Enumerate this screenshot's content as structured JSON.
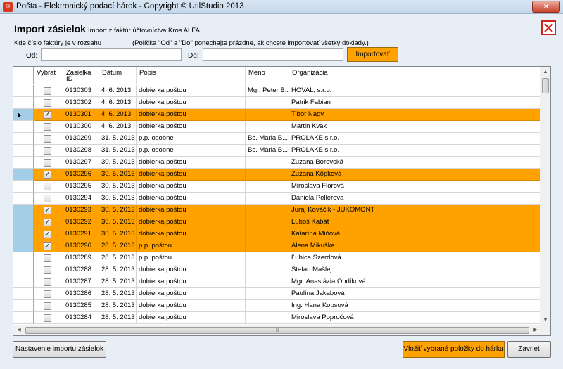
{
  "window": {
    "title": "Pošta - Elektronický podací hárok - Copyright © UtilStudio 2013",
    "close_glyph": "✕"
  },
  "header": {
    "title": "Import zásielok",
    "subtitle": "Import z faktúr účtovníctva Kros ALFA"
  },
  "range": {
    "label": "Kde číslo faktúry je v rozsahu",
    "hint": "(Políčka \"Od\" a \"Do\" ponechajte prázdne, ak chcete importovať všetky doklady.)",
    "od_label": "Od:",
    "od_value": "",
    "do_label": "Do:",
    "do_value": "",
    "import_button": "Importovať"
  },
  "columns": {
    "vybrat": "Vybrať",
    "zasielka": "Zásielka ID",
    "datum": "Dátum",
    "popis": "Popis",
    "meno": "Meno",
    "organizacia": "Organizácia"
  },
  "rows": [
    {
      "checked": false,
      "selected": false,
      "current": false,
      "id": "0130303",
      "date": "4. 6. 2013",
      "desc": "dobierka poštou",
      "name": "Mgr. Peter B...",
      "org": "HOVAL, s.r.o."
    },
    {
      "checked": false,
      "selected": false,
      "current": false,
      "id": "0130302",
      "date": "4. 6. 2013",
      "desc": "dobierka poštou",
      "name": "",
      "org": "Patrik Fabian"
    },
    {
      "checked": true,
      "selected": true,
      "current": true,
      "id": "0130301",
      "date": "4. 6. 2013",
      "desc": "dobierka poštou",
      "name": "",
      "org": "Tibor Nagy"
    },
    {
      "checked": false,
      "selected": false,
      "current": false,
      "id": "0130300",
      "date": "4. 6. 2013",
      "desc": "dobierka poštou",
      "name": "",
      "org": "Martin Kvak"
    },
    {
      "checked": false,
      "selected": false,
      "current": false,
      "id": "0130299",
      "date": "31. 5. 2013",
      "desc": "p.p. osobne",
      "name": "Bc. Mária B...",
      "org": "PROLAKE s.r.o."
    },
    {
      "checked": false,
      "selected": false,
      "current": false,
      "id": "0130298",
      "date": "31. 5. 2013",
      "desc": "p.p. osobne",
      "name": "Bc. Mária B...",
      "org": "PROLAKE s.r.o."
    },
    {
      "checked": false,
      "selected": false,
      "current": false,
      "id": "0130297",
      "date": "30. 5. 2013",
      "desc": "dobierka poštou",
      "name": "",
      "org": "Zuzana Borovská"
    },
    {
      "checked": true,
      "selected": true,
      "current": false,
      "id": "0130296",
      "date": "30. 5. 2013",
      "desc": "dobierka poštou",
      "name": "",
      "org": "Zuzana Kôpková"
    },
    {
      "checked": false,
      "selected": false,
      "current": false,
      "id": "0130295",
      "date": "30. 5. 2013",
      "desc": "dobierka poštou",
      "name": "",
      "org": "Miroslava Flórová"
    },
    {
      "checked": false,
      "selected": false,
      "current": false,
      "id": "0130294",
      "date": "30. 5. 2013",
      "desc": "dobierka poštou",
      "name": "",
      "org": "Daniela Pellerova"
    },
    {
      "checked": true,
      "selected": true,
      "current": false,
      "id": "0130293",
      "date": "30. 5. 2013",
      "desc": "dobierka poštou",
      "name": "",
      "org": "Juraj Kováčik - JUKOMONT"
    },
    {
      "checked": true,
      "selected": true,
      "current": false,
      "id": "0130292",
      "date": "30. 5. 2013",
      "desc": "dobierka poštou",
      "name": "",
      "org": "Luboš Kabát"
    },
    {
      "checked": true,
      "selected": true,
      "current": false,
      "id": "0130291",
      "date": "30. 5. 2013",
      "desc": "dobierka poštou",
      "name": "",
      "org": "Katarína Miňová"
    },
    {
      "checked": true,
      "selected": true,
      "current": false,
      "id": "0130290",
      "date": "28. 5. 2013",
      "desc": "p.p. poštou",
      "name": "",
      "org": "Alena Mikuška"
    },
    {
      "checked": false,
      "selected": false,
      "current": false,
      "id": "0130289",
      "date": "28. 5. 2013",
      "desc": "p.p. poštou",
      "name": "",
      "org": "Ľubica Szerdová"
    },
    {
      "checked": false,
      "selected": false,
      "current": false,
      "id": "0130288",
      "date": "28. 5. 2013",
      "desc": "dobierka poštou",
      "name": "",
      "org": "Štefan Mašlej"
    },
    {
      "checked": false,
      "selected": false,
      "current": false,
      "id": "0130287",
      "date": "28. 5. 2013",
      "desc": "dobierka poštou",
      "name": "",
      "org": "Mgr. Anastázia Ondíková"
    },
    {
      "checked": false,
      "selected": false,
      "current": false,
      "id": "0130286",
      "date": "28. 5. 2013",
      "desc": "dobierka poštou",
      "name": "",
      "org": "Paulína Jakabová"
    },
    {
      "checked": false,
      "selected": false,
      "current": false,
      "id": "0130285",
      "date": "28. 5. 2013",
      "desc": "dobierka poštou",
      "name": "",
      "org": "Ing. Hana Kopsová"
    },
    {
      "checked": false,
      "selected": false,
      "current": false,
      "id": "0130284",
      "date": "28. 5. 2013",
      "desc": "dobierka poštou",
      "name": "",
      "org": "Miroslava Popročová"
    }
  ],
  "scroll": {
    "up": "▲",
    "down": "▼",
    "left": "◀",
    "right": "▶",
    "grip": "|||"
  },
  "footer": {
    "settings_button": "Nastavenie importu zásielok",
    "insert_button": "Vložiť vybrané položky do hárku",
    "close_button": "Zavrieť"
  },
  "colors": {
    "selection": "#ffa200",
    "row_header_selected": "#a4cde8",
    "close_red": "#d3241a"
  }
}
